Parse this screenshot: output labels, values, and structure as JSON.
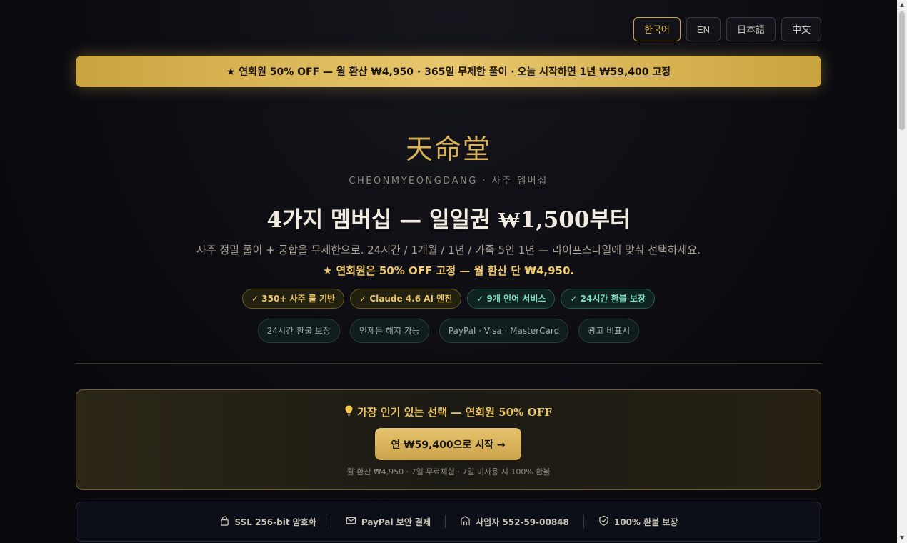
{
  "language_switch": {
    "items": [
      {
        "label": "한국어",
        "active": true
      },
      {
        "label": "EN",
        "active": false
      },
      {
        "label": "日本語",
        "active": false
      },
      {
        "label": "中文",
        "active": false
      }
    ]
  },
  "promo_banner": {
    "text": "★ 연회원 50% OFF — 월 환산 ₩4,950 · 365일 무제한 풀이 ·",
    "link_text": "오늘 시작하면 1년 ₩59,400 고정"
  },
  "hero": {
    "logo": "天命堂",
    "tagline": "CHEONMYEONGDANG · 사주 멤버십",
    "headline": "4가지 멤버십 — 일일권 ₩1,500부터",
    "description": "사주 정밀 풀이 + 궁합을 무제한으로. 24시간 / 1개월 / 1년 / 가족 5인 1년 — 라이프스타일에 맞춰 선택하세요.",
    "offer": "★ 연회원은 50% OFF 고정 — 월 환산 단 ₩4,950.",
    "badges": [
      {
        "label": "✓ 350+ 사주 룰 기반",
        "style": "gold"
      },
      {
        "label": "✓ Claude 4.6 AI 엔진",
        "style": "gold"
      },
      {
        "label": "✓ 9개 언어 서비스",
        "style": "green"
      },
      {
        "label": "✓ 24시간 환불 보장",
        "style": "green"
      }
    ],
    "pills": [
      "24시간 환불 보장",
      "언제든 해지 가능",
      "PayPal · Visa · MasterCard",
      "광고 비표시"
    ]
  },
  "cta": {
    "icon": "lightbulb-icon",
    "title": "가장 인기 있는 선택 — 연회원 50% OFF",
    "button_label": "연 ₩59,400으로 시작 →",
    "subtext": "월 환산 ₩4,950 · 7일 무료체험 · 7일 미사용 시 100% 환불"
  },
  "trust_bar": {
    "items": [
      {
        "icon": "lock-icon",
        "label": "SSL 256-bit 암호화"
      },
      {
        "icon": "mail-icon",
        "label": "PayPal 보안 결제"
      },
      {
        "icon": "building-icon",
        "label": "사업자 552-59-00848"
      },
      {
        "icon": "shield-check-icon",
        "label": "100% 환불 보장"
      }
    ]
  },
  "colors": {
    "accent_gold": "#d8b35a",
    "background": "#0b0b10",
    "green_badge": "#7fe0c0"
  }
}
